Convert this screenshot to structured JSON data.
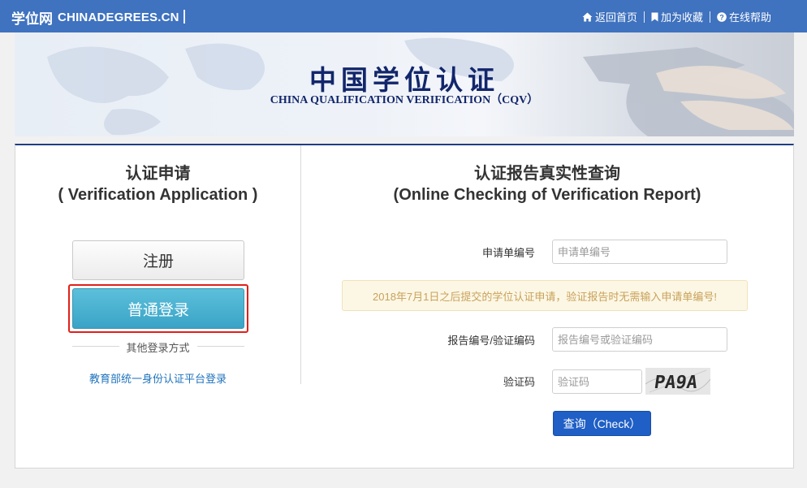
{
  "topbar": {
    "brand_cn": "学位网",
    "brand_en": "CHINADEGREES.CN",
    "links": [
      {
        "icon": "home-icon",
        "label": "返回首页"
      },
      {
        "icon": "bookmark-icon",
        "label": "加为收藏"
      },
      {
        "icon": "help-icon",
        "label": "在线帮助"
      }
    ],
    "bg_color": "#3f72bf"
  },
  "banner": {
    "title": "中国学位认证",
    "subtitle": "CHINA QUALIFICATION VERIFICATION（CQV）"
  },
  "application": {
    "title_cn": "认证申请",
    "title_en": "( Verification Application )",
    "register_label": "注册",
    "login_label": "普通登录",
    "other_login_label": "其他登录方式",
    "edu_login_link": "教育部统一身份认证平台登录"
  },
  "checking": {
    "title_cn": "认证报告真实性查询",
    "title_en": "(Online Checking of Verification Report)",
    "app_no_label": "申请单编号",
    "app_no_placeholder": "申请单编号",
    "notice": "2018年7月1日之后提交的学位认证申请，验证报告时无需输入申请单编号!",
    "report_no_label": "报告编号/验证编码",
    "report_no_placeholder": "报告编号或验证编码",
    "captcha_label": "验证码",
    "captcha_placeholder": "验证码",
    "captcha_text": "PA9A",
    "check_button": "查询（Check）"
  },
  "colors": {
    "accent_blue": "#1f5fc6",
    "login_teal": "#3aa3c6",
    "highlight_red": "#e0201a",
    "notice_text": "#c9a15a"
  }
}
